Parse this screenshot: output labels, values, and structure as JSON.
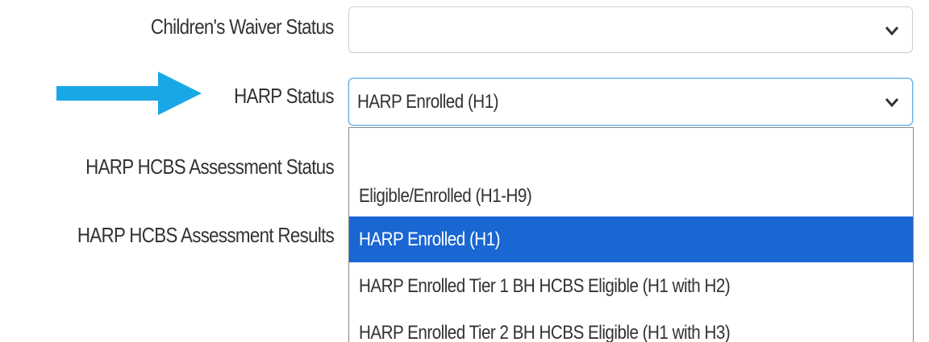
{
  "form": {
    "fields": [
      {
        "label": "Children's Waiver Status",
        "value": ""
      },
      {
        "label": "HARP Status",
        "value": "HARP Enrolled (H1)"
      },
      {
        "label": "HARP HCBS Assessment Status"
      },
      {
        "label": "HARP HCBS Assessment Results"
      }
    ]
  },
  "dropdown": {
    "options": [
      "",
      "Eligible/Enrolled (H1-H9)",
      "HARP Enrolled (H1)",
      "HARP Enrolled Tier 1 BH HCBS Eligible (H1 with H2)",
      "HARP Enrolled Tier 2 BH HCBS Eligible (H1 with H3)"
    ],
    "selected_index": 2
  },
  "icons": {
    "select_chevron": "chevron-down-icon",
    "annotation": "right-arrow-icon"
  },
  "colors": {
    "arrow": "#1aa7e6",
    "selected_option_bg": "#1a66d2",
    "focus_border": "#66afe9"
  }
}
